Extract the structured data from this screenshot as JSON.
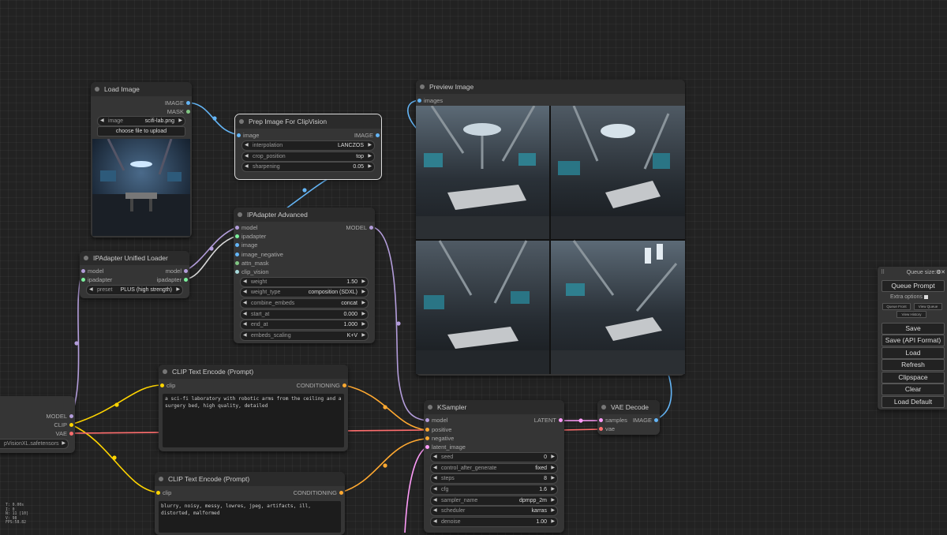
{
  "colors": {
    "model": "#b39ddb",
    "clip": "#ffd500",
    "vae": "#ff6e6e",
    "image": "#64b5f6",
    "conditioning": "#ffa931",
    "latent": "#ff9cf9",
    "ipadapter": "#7cf09e",
    "mask": "#81c784",
    "clip_vision": "#a8dadc"
  },
  "load_image": {
    "title": "Load Image",
    "out_image": "IMAGE",
    "out_mask": "MASK",
    "image_label": "image",
    "image_value": "scifi-lab.png",
    "upload_label": "choose file to upload"
  },
  "prep_image": {
    "title": "Prep Image For ClipVision",
    "in_image": "image",
    "out_image": "IMAGE",
    "interpolation_label": "interpolation",
    "interpolation_value": "LANCZOS",
    "crop_label": "crop_position",
    "crop_value": "top",
    "sharpening_label": "sharpening",
    "sharpening_value": "0.05"
  },
  "ipadapter_advanced": {
    "title": "IPAdapter Advanced",
    "inputs": [
      "model",
      "ipadapter",
      "image",
      "image_negative",
      "attn_mask",
      "clip_vision"
    ],
    "out_model": "MODEL",
    "widgets": [
      {
        "label": "weight",
        "value": "1.50"
      },
      {
        "label": "weight_type",
        "value": "composition (SDXL)"
      },
      {
        "label": "combine_embeds",
        "value": "concat"
      },
      {
        "label": "start_at",
        "value": "0.000"
      },
      {
        "label": "end_at",
        "value": "1.000"
      },
      {
        "label": "embeds_scaling",
        "value": "K+V"
      }
    ]
  },
  "unified_loader": {
    "title": "IPAdapter Unified Loader",
    "in_model": "model",
    "in_ipadapter": "ipadapter",
    "out_model": "model",
    "out_ipadapter": "ipadapter",
    "preset_label": "preset",
    "preset_value": "PLUS (high strength)"
  },
  "checkpoint": {
    "out_model": "MODEL",
    "out_clip": "CLIP",
    "out_vae": "VAE",
    "ckpt_value": "pVisionXL.safetensors"
  },
  "clip_pos": {
    "title": "CLIP Text Encode (Prompt)",
    "in_clip": "clip",
    "out_cond": "CONDITIONING",
    "text": "a sci-fi laboratory with robotic arms from the ceiling and a surgery bed, high quality, detailed"
  },
  "clip_neg": {
    "title": "CLIP Text Encode (Prompt)",
    "in_clip": "clip",
    "out_cond": "CONDITIONING",
    "text": "blurry, noisy, messy, lowres, jpeg, artifacts, ill, distorted, malformed"
  },
  "preview": {
    "title": "Preview Image",
    "in_images": "images"
  },
  "ksampler": {
    "title": "KSampler",
    "inputs": [
      "model",
      "positive",
      "negative",
      "latent_image"
    ],
    "out_latent": "LATENT",
    "widgets": [
      {
        "label": "seed",
        "value": "0"
      },
      {
        "label": "control_after_generate",
        "value": "fixed"
      },
      {
        "label": "steps",
        "value": "8"
      },
      {
        "label": "cfg",
        "value": "1.6"
      },
      {
        "label": "sampler_name",
        "value": "dpmpp_2m"
      },
      {
        "label": "scheduler",
        "value": "karras"
      },
      {
        "label": "denoise",
        "value": "1.00"
      }
    ]
  },
  "vae_decode": {
    "title": "VAE Decode",
    "in_samples": "samples",
    "in_vae": "vae",
    "out_image": "IMAGE"
  },
  "queue": {
    "size_label": "Queue size: 0",
    "queue_prompt": "Queue Prompt",
    "extra_options": "Extra options",
    "queue_front": "Queue Front",
    "view_queue": "View Queue",
    "view_history": "View History",
    "save": "Save",
    "save_api": "Save (API Format)",
    "load": "Load",
    "refresh": "Refresh",
    "clipspace": "Clipspace",
    "clear": "Clear",
    "load_default": "Load Default"
  },
  "stats": [
    "T: 0.00s",
    "I: 0",
    "N: 11 [10]",
    "V: 98",
    "FPS:58.82"
  ]
}
